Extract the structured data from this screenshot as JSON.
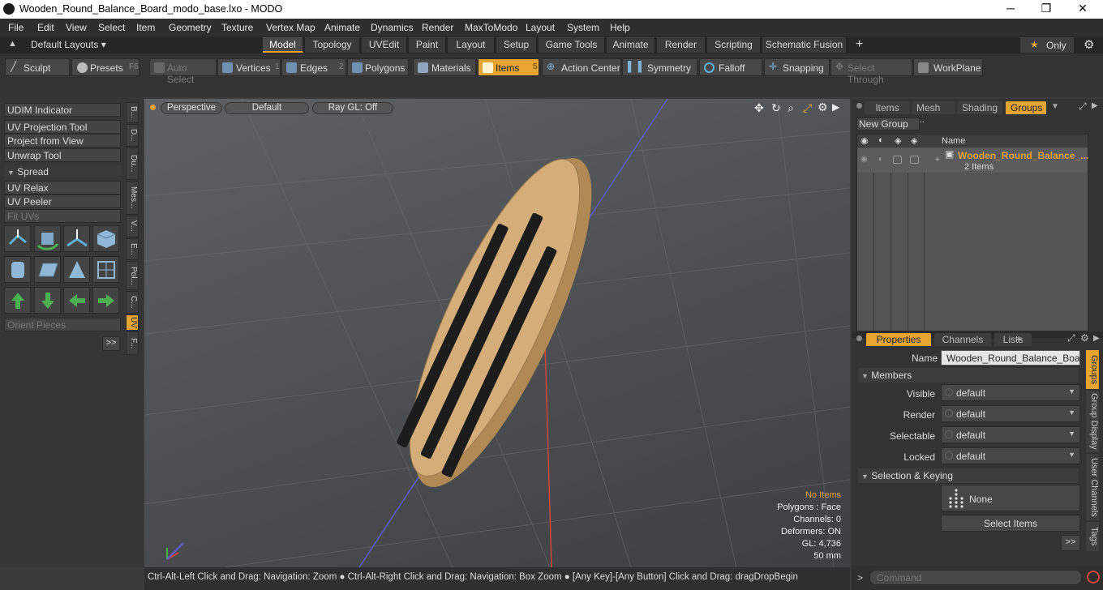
{
  "window": {
    "title": "Wooden_Round_Balance_Board_modo_base.lxo - MODO",
    "minimize": "─",
    "maximize": "❐",
    "close": "✕"
  },
  "menu": [
    "File",
    "Edit",
    "View",
    "Select",
    "Item",
    "Geometry",
    "Texture",
    "Vertex Map",
    "Animate",
    "Dynamics",
    "Render",
    "MaxToModo",
    "Layout",
    "System",
    "Help"
  ],
  "layouts": {
    "label": "Default Layouts ▾",
    "tabs": [
      "Model",
      "Topology",
      "UVEdit",
      "Paint",
      "Layout",
      "Setup",
      "Game Tools",
      "Animate",
      "Render",
      "Scripting",
      "Schematic Fusion"
    ],
    "active": "Model",
    "plus": "+",
    "only": "Only"
  },
  "toolbar": {
    "sculpt": "Sculpt",
    "presets": "Presets",
    "presets_key": "F6",
    "auto_select": "Auto Select",
    "vertices": "Vertices",
    "vertices_num": "1",
    "edges": "Edges",
    "edges_num": "2",
    "polygons": "Polygons",
    "materials": "Materials",
    "items": "Items",
    "items_num": "5",
    "action_center": "Action Center",
    "symmetry": "Symmetry",
    "falloff": "Falloff",
    "snapping": "Snapping",
    "select_through": "Select Through",
    "workplane": "WorkPlane"
  },
  "left_tools": {
    "udim": "UDIM Indicator",
    "uv_projection": "UV Projection Tool",
    "project_view": "Project from View",
    "unwrap": "Unwrap Tool",
    "spread": "Spread",
    "uv_relax": "UV Relax",
    "uv_peeler": "UV Peeler",
    "fit_uvs": "Fit UVs",
    "orient": "Orient Pieces",
    "more": ">>"
  },
  "vtabs": [
    "B...",
    "D...",
    "Du...",
    "Mes...",
    "V...",
    "E...",
    "Pol...",
    "C...",
    "UV",
    "F..."
  ],
  "viewport": {
    "perspective": "Perspective",
    "default": "Default",
    "raygl": "Ray GL: Off",
    "stats": {
      "no_items": "No Items",
      "polygons": "Polygons : Face",
      "channels": "Channels: 0",
      "deformers": "Deformers: ON",
      "gl": "GL: 4,736",
      "mm": "50 mm"
    }
  },
  "status": "Ctrl-Alt-Left Click and Drag: Navigation: Zoom ● Ctrl-Alt-Right Click and Drag: Navigation: Box Zoom ● [Any Key]-[Any Button] Click and Drag: dragDropBegin",
  "groups_panel": {
    "tabs": [
      "Items",
      "Mesh ...",
      "Shading",
      "Groups"
    ],
    "active": "Groups",
    "new_group": "New Group",
    "col_name": "Name",
    "item_name": "Wooden_Round_Balance_...",
    "item_count": "2 Items"
  },
  "properties": {
    "tabs": [
      "Properties",
      "Channels",
      "Lists"
    ],
    "active": "Properties",
    "plus": "+",
    "name_label": "Name",
    "name_value": "Wooden_Round_Balance_Board (",
    "members": "Members",
    "visible": "Visible",
    "render": "Render",
    "selectable": "Selectable",
    "locked": "Locked",
    "default_val": "default",
    "selection_keying": "Selection & Keying",
    "none": "None",
    "select_items": "Select Items",
    "more": ">>",
    "side_tabs": [
      "Groups",
      "Group Display",
      "User Channels",
      "Tags"
    ]
  },
  "command": {
    "placeholder": "Command",
    "prompt": ">"
  },
  "colors": {
    "accent": "#e8a431",
    "wood": "#c9a471",
    "grip": "#1c1c1c"
  }
}
